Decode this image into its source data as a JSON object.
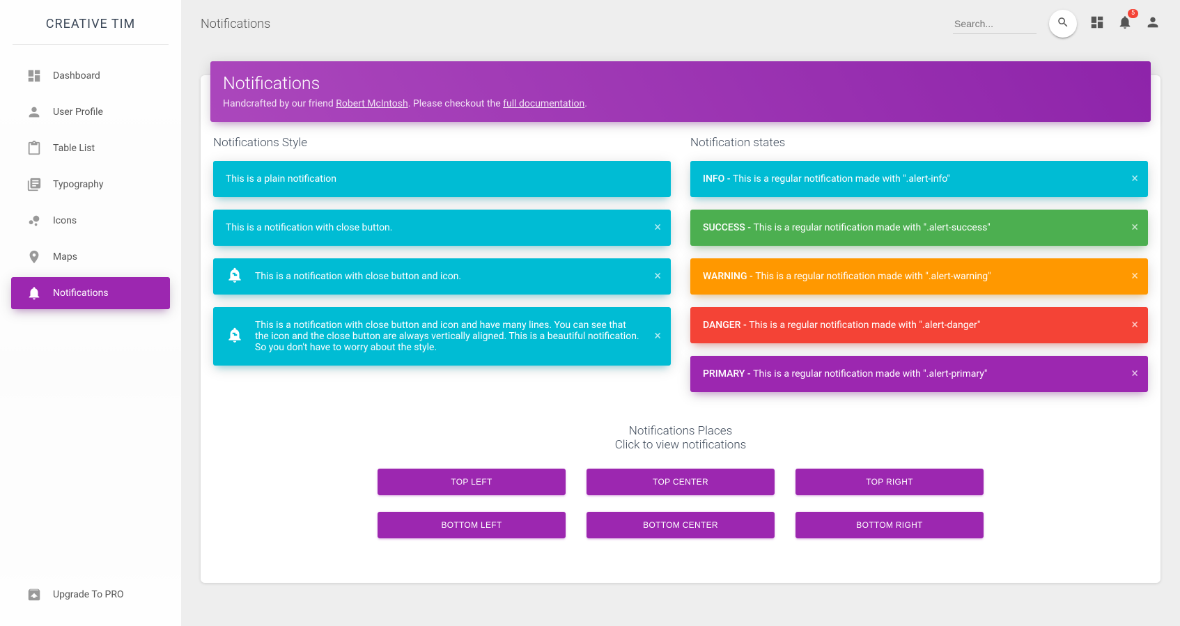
{
  "brand": "CREATIVE TIM",
  "sidebar": {
    "items": [
      {
        "label": "Dashboard"
      },
      {
        "label": "User Profile"
      },
      {
        "label": "Table List"
      },
      {
        "label": "Typography"
      },
      {
        "label": "Icons"
      },
      {
        "label": "Maps"
      },
      {
        "label": "Notifications"
      }
    ],
    "upgrade": "Upgrade To PRO"
  },
  "topbar": {
    "page_title": "Notifications",
    "search_placeholder": "Search...",
    "badge_count": "5"
  },
  "card_header": {
    "title": "Notifications",
    "pre": "Handcrafted by our friend ",
    "author": "Robert McIntosh",
    "mid": ". Please checkout the ",
    "doc": "full documentation",
    "end": "."
  },
  "style_section_title": "Notifications Style",
  "states_section_title": "Notification states",
  "style_alerts": {
    "plain": "This is a plain notification",
    "close": "This is a notification with close button.",
    "icon": "This is a notification with close button and icon.",
    "long": "This is a notification with close button and icon and have many lines. You can see that the icon and the close button are always vertically aligned. This is a beautiful notification. So you don't have to worry about the style."
  },
  "state_alerts": {
    "info_label": "INFO - ",
    "info_text": "This is a regular notification made with \".alert-info\"",
    "success_label": "SUCCESS - ",
    "success_text": "This is a regular notification made with \".alert-success\"",
    "warning_label": "WARNING - ",
    "warning_text": "This is a regular notification made with \".alert-warning\"",
    "danger_label": "DANGER - ",
    "danger_text": "This is a regular notification made with \".alert-danger\"",
    "primary_label": "PRIMARY - ",
    "primary_text": "This is a regular notification made with \".alert-primary\""
  },
  "places": {
    "title": "Notifications Places",
    "subtitle": "Click to view notifications",
    "buttons": {
      "top_left": "Top Left",
      "top_center": "Top Center",
      "top_right": "Top Right",
      "bottom_left": "Bottom Left",
      "bottom_center": "Bottom Center",
      "bottom_right": "Bottom Right"
    }
  }
}
